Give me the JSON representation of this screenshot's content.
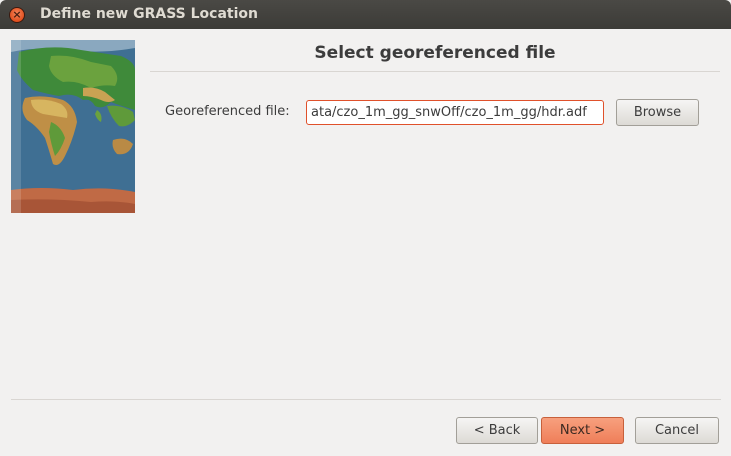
{
  "window": {
    "title": "Define new GRASS Location",
    "close_glyph": "×"
  },
  "page": {
    "heading": "Select georeferenced file"
  },
  "form": {
    "georef_label": "Georeferenced file:",
    "georef_value": "ata/czo_1m_gg_snwOff/czo_1m_gg/hdr.adf",
    "browse_label": "Browse"
  },
  "footer": {
    "back_label": "< Back",
    "next_label": "Next >",
    "cancel_label": "Cancel"
  },
  "colors": {
    "accent": "#e0512b",
    "next_button": "#ef7e59",
    "titlebar": "#3c3b37"
  },
  "icons": {
    "close": "close-icon",
    "map": "world-map-image"
  }
}
